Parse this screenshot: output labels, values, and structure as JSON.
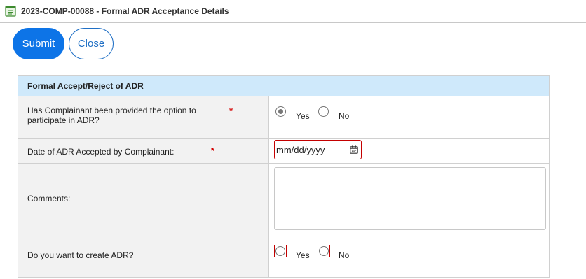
{
  "window": {
    "title": "2023-COMP-00088 - Formal ADR Acceptance Details"
  },
  "toolbar": {
    "submit_label": "Submit",
    "close_label": "Close"
  },
  "form": {
    "section_title": "Formal Accept/Reject of ADR",
    "required_mark": "*",
    "q_option_provided": {
      "label": "Has Complainant been provided the option to participate in ADR?",
      "options": [
        "Yes",
        "No"
      ],
      "selected": "Yes"
    },
    "date_accepted": {
      "label": "Date of ADR Accepted by Complainant:",
      "placeholder": "mm/dd/yyyy"
    },
    "comments": {
      "label": "Comments:",
      "value": ""
    },
    "create_adr": {
      "label": "Do you want to create ADR?",
      "options": [
        "Yes",
        "No"
      ],
      "selected": null
    }
  },
  "colors": {
    "primary": "#0d74e7",
    "header_bg": "#cfe9fb",
    "label_bg": "#f2f2f2",
    "required": "#d40000",
    "error_border": "#c40000"
  },
  "icons": {
    "window": "form-document-icon",
    "date": "calendar-icon"
  }
}
